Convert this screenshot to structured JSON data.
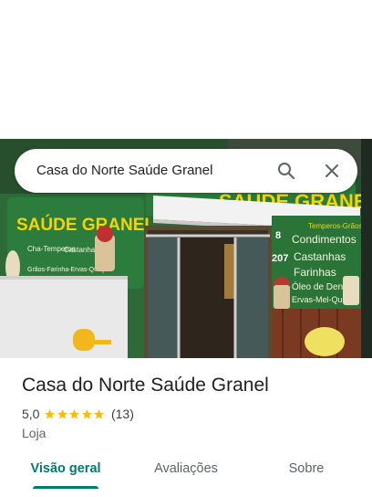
{
  "search": {
    "query": "Casa do Norte Saúde Granel",
    "search_icon": "search-icon",
    "close_icon": "close-icon"
  },
  "photo": {
    "sign_left": "SAÚDE GRANEL",
    "sign_top": "SAÚDE GRANEL",
    "sign_left_lines": [
      "Cha-Temperos",
      "Castanhas",
      "Grãos-Farinha-Ervas-Queijo"
    ],
    "house_number_1": "8",
    "house_number_2": "207",
    "sign_right_lines": [
      "Temperos-Grãos",
      "Condimentos",
      "Castanhas",
      "Farinhas",
      "Óleo de Dendê",
      "Ervas-Mel-Queijo"
    ]
  },
  "place": {
    "name": "Casa do Norte Saúde Granel",
    "rating": "5,0",
    "stars": 5,
    "reviews": "(13)",
    "category": "Loja"
  },
  "tabs": [
    {
      "label": "Visão geral",
      "active": true
    },
    {
      "label": "Avaliações",
      "active": false
    },
    {
      "label": "Sobre",
      "active": false
    }
  ],
  "colors": {
    "accent": "#01796f",
    "star": "#fbbc04",
    "storefront_green": "#2f6b3a"
  }
}
